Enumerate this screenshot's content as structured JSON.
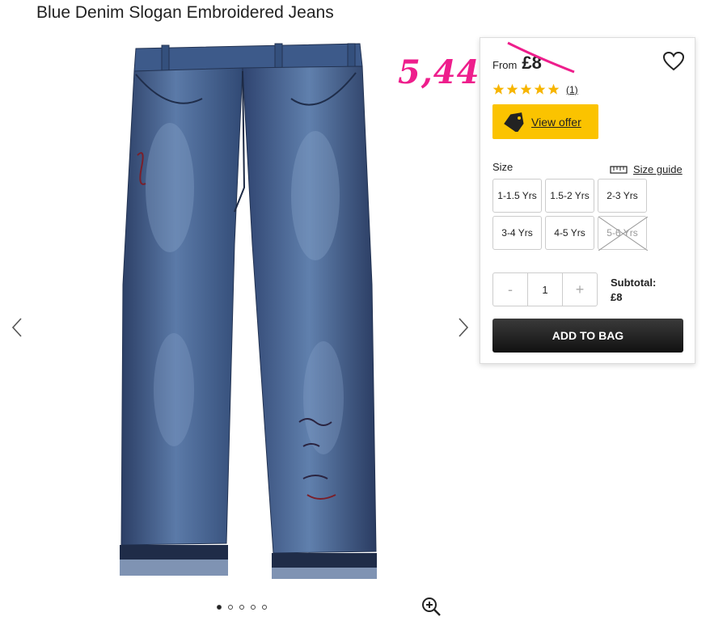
{
  "product": {
    "title": "Blue Denim Slogan Embroidered Jeans"
  },
  "annotation": {
    "handwritten_price": "5,44",
    "color": "#ee1e8c"
  },
  "gallery": {
    "image_alt": "jeans-product-image",
    "dots": 5,
    "active_dot": 0
  },
  "panel": {
    "from_label": "From",
    "price": "£8",
    "rating_stars": 5,
    "review_count": "(1)",
    "offer_label": "View offer",
    "offer_color": "#fbc300",
    "size_label": "Size",
    "size_guide_label": "Size guide",
    "sizes": [
      {
        "label": "1-1.5 Yrs",
        "available": true
      },
      {
        "label": "1.5-2 Yrs",
        "available": true
      },
      {
        "label": "2-3 Yrs",
        "available": true
      },
      {
        "label": "3-4 Yrs",
        "available": true
      },
      {
        "label": "4-5 Yrs",
        "available": true
      },
      {
        "label": "5-6 Yrs",
        "available": false
      }
    ],
    "qty_minus": "-",
    "qty_value": "1",
    "qty_plus": "+",
    "subtotal_label": "Subtotal:",
    "subtotal_value": "£8",
    "add_to_bag": "ADD TO BAG"
  }
}
